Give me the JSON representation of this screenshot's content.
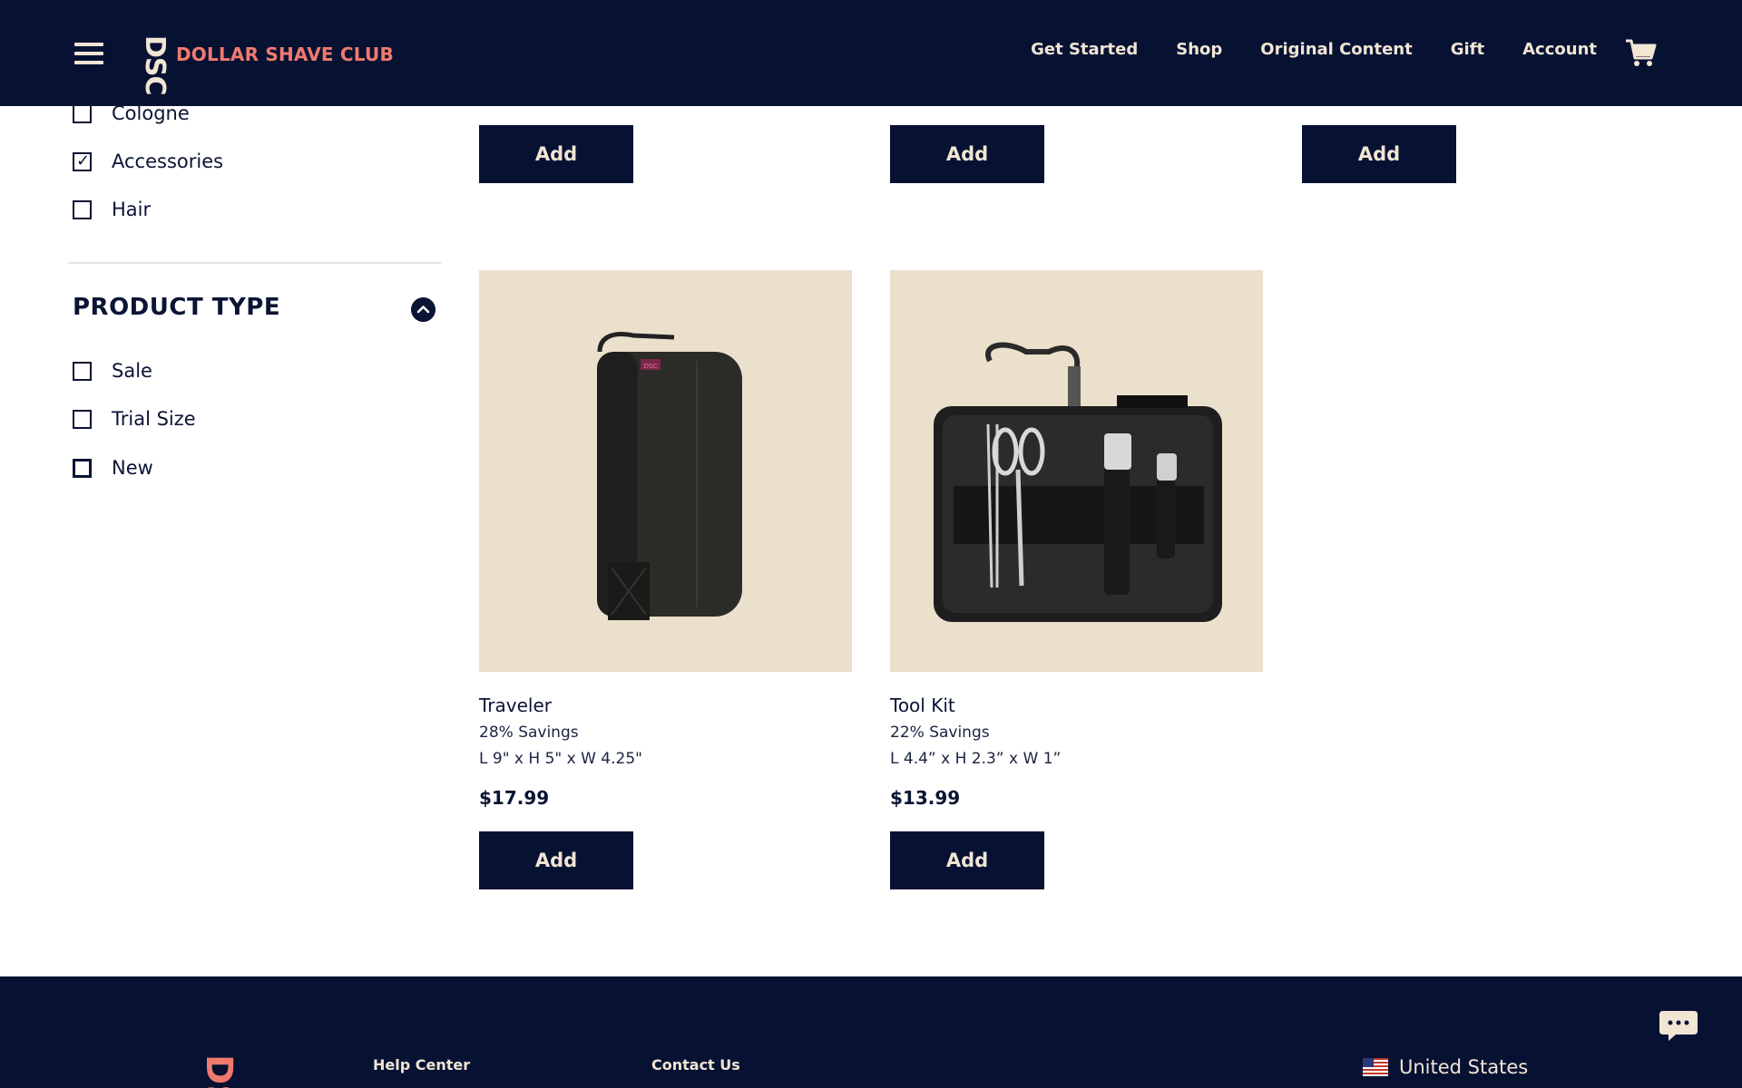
{
  "brand": {
    "logo_mark": "DSC",
    "name": "DOLLAR SHAVE CLUB",
    "accent_color": "#f07a6e",
    "navy": "#071233",
    "cream": "#f1e5d4"
  },
  "nav": {
    "items": [
      "Get Started",
      "Shop",
      "Original Content",
      "Gift",
      "Account"
    ]
  },
  "filters": {
    "category": [
      {
        "label": "Cologne",
        "checked": false
      },
      {
        "label": "Accessories",
        "checked": true
      },
      {
        "label": "Hair",
        "checked": false
      }
    ],
    "product_type_title": "PRODUCT TYPE",
    "product_type": [
      {
        "label": "Sale",
        "checked": false
      },
      {
        "label": "Trial Size",
        "checked": false
      },
      {
        "label": "New",
        "checked": false
      }
    ]
  },
  "grid": {
    "top_row_add_labels": [
      "Add",
      "Add",
      "Add"
    ],
    "products": [
      {
        "name": "Traveler",
        "savings": "28% Savings",
        "dimensions": "L 9\" x H 5\" x W 4.25\"",
        "price": "$17.99",
        "add_label": "Add"
      },
      {
        "name": "Tool Kit",
        "savings": "22% Savings",
        "dimensions": "L 4.4” x H 2.3” x W 1”",
        "price": "$13.99",
        "add_label": "Add"
      }
    ]
  },
  "footer": {
    "logo_mark": "DSC",
    "links": [
      "Help Center",
      "Contact Us"
    ],
    "country": "United States"
  }
}
